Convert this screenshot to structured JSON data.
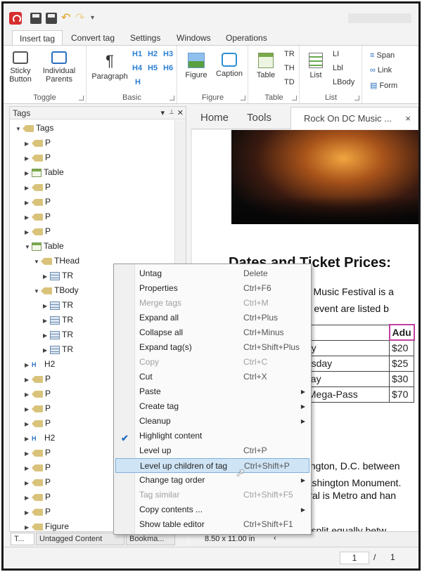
{
  "quick_access": {
    "more": "▾"
  },
  "ribbon_tabs": [
    "Insert tag",
    "Convert tag",
    "Settings",
    "Windows",
    "Operations"
  ],
  "ribbon": {
    "toggle": {
      "label": "Toggle",
      "sticky": "Sticky\nButton",
      "individual": "Individual\nParents"
    },
    "basic": {
      "label": "Basic",
      "paragraph": "Paragraph",
      "headings": [
        "H1",
        "H2",
        "H3",
        "H4",
        "H5",
        "H6",
        "H"
      ]
    },
    "figure": {
      "label": "Figure",
      "figure": "Figure",
      "caption": "Caption"
    },
    "table": {
      "label": "Table",
      "table": "Table",
      "tr": "TR",
      "th": "TH",
      "td": "TD"
    },
    "list": {
      "label": "List",
      "list": "List",
      "li": "LI",
      "lbl": "Lbl",
      "lbody": "LBody"
    },
    "inline": {
      "span": "Span",
      "link": "Link",
      "form": "Form"
    }
  },
  "tags_panel": {
    "title": "Tags",
    "controls": {
      "dropdown": "▾",
      "pin": "📌",
      "close": "✕"
    },
    "tree": [
      {
        "label": "Tags",
        "kind": "tag",
        "indent": 0,
        "expanded": true
      },
      {
        "label": "P",
        "kind": "tag",
        "indent": 1
      },
      {
        "label": "P",
        "kind": "tag",
        "indent": 1
      },
      {
        "label": "Table",
        "kind": "table",
        "indent": 1
      },
      {
        "label": "P",
        "kind": "tag",
        "indent": 1
      },
      {
        "label": "P",
        "kind": "tag",
        "indent": 1
      },
      {
        "label": "P",
        "kind": "tag",
        "indent": 1
      },
      {
        "label": "P",
        "kind": "tag",
        "indent": 1
      },
      {
        "label": "Table",
        "kind": "table",
        "indent": 1,
        "expanded": true
      },
      {
        "label": "THead",
        "kind": "tag",
        "indent": 2,
        "expanded": true
      },
      {
        "label": "TR",
        "kind": "tr",
        "indent": 3
      },
      {
        "label": "TBody",
        "kind": "tag",
        "indent": 2,
        "expanded": true
      },
      {
        "label": "TR",
        "kind": "tr",
        "indent": 3
      },
      {
        "label": "TR",
        "kind": "tr",
        "indent": 3
      },
      {
        "label": "TR",
        "kind": "tr",
        "indent": 3
      },
      {
        "label": "TR",
        "kind": "tr",
        "indent": 3
      },
      {
        "label": "H2",
        "kind": "h2",
        "indent": 1
      },
      {
        "label": "P",
        "kind": "tag",
        "indent": 1
      },
      {
        "label": "P",
        "kind": "tag",
        "indent": 1
      },
      {
        "label": "P",
        "kind": "tag",
        "indent": 1
      },
      {
        "label": "P",
        "kind": "tag",
        "indent": 1
      },
      {
        "label": "H2",
        "kind": "h2",
        "indent": 1
      },
      {
        "label": "P",
        "kind": "tag",
        "indent": 1
      },
      {
        "label": "P",
        "kind": "tag",
        "indent": 1
      },
      {
        "label": "P",
        "kind": "tag",
        "indent": 1
      },
      {
        "label": "P",
        "kind": "tag",
        "indent": 1
      },
      {
        "label": "P",
        "kind": "tag",
        "indent": 1
      },
      {
        "label": "Figure",
        "kind": "tag",
        "indent": 1
      }
    ],
    "bottom_tabs": [
      "T...",
      "Untagged Content",
      "Bookma..."
    ]
  },
  "document": {
    "tabs": {
      "home": "Home",
      "tools": "Tools",
      "file": "Rock On DC Music ...",
      "close": "×"
    },
    "heading": "Dates and Ticket Prices:",
    "line1": "C.” Music Festival is a",
    "line2": "the event are listed b",
    "table": [
      [
        "",
        "Adu"
      ],
      [
        "day",
        "$20"
      ],
      [
        "nesday",
        "$25"
      ],
      [
        "sday",
        "$30"
      ],
      [
        "y Mega-Pass",
        "$70"
      ]
    ],
    "line3": "shington, D.C. between",
    "line4": "Washington Monument.",
    "line5": "stival is Metro and han",
    "line6": "be split equally betw",
    "page_size": "8.50 x 11.00 in",
    "page_current": "1",
    "page_sep": "/",
    "page_total": "1"
  },
  "context_menu": [
    {
      "label": "Untag",
      "shortcut": "Delete"
    },
    {
      "label": "Properties",
      "shortcut": "Ctrl+F6"
    },
    {
      "label": "Merge tags",
      "shortcut": "Ctrl+M",
      "disabled": true
    },
    {
      "label": "Expand all",
      "shortcut": "Ctrl+Plus"
    },
    {
      "label": "Collapse all",
      "shortcut": "Ctrl+Minus"
    },
    {
      "label": "Expand tag(s)",
      "shortcut": "Ctrl+Shift+Plus"
    },
    {
      "label": "Copy",
      "shortcut": "Ctrl+C",
      "disabled": true
    },
    {
      "label": "Cut",
      "shortcut": "Ctrl+X"
    },
    {
      "label": "Paste",
      "shortcut": "",
      "submenu": true
    },
    {
      "label": "Create tag",
      "shortcut": "",
      "submenu": true
    },
    {
      "label": "Cleanup",
      "shortcut": "",
      "submenu": true
    },
    {
      "label": "Highlight content",
      "shortcut": "",
      "checked": true
    },
    {
      "label": "Level up",
      "shortcut": "Ctrl+P"
    },
    {
      "label": "Level up children of tag",
      "shortcut": "Ctrl+Shift+P",
      "highlighted": true
    },
    {
      "label": "Change tag order",
      "shortcut": "",
      "submenu": true
    },
    {
      "label": "Tag similar",
      "shortcut": "Ctrl+Shift+F5",
      "disabled": true
    },
    {
      "label": "Copy contents ...",
      "shortcut": "",
      "submenu": true
    },
    {
      "label": "Show table editor",
      "shortcut": "Ctrl+Shift+F1"
    }
  ]
}
